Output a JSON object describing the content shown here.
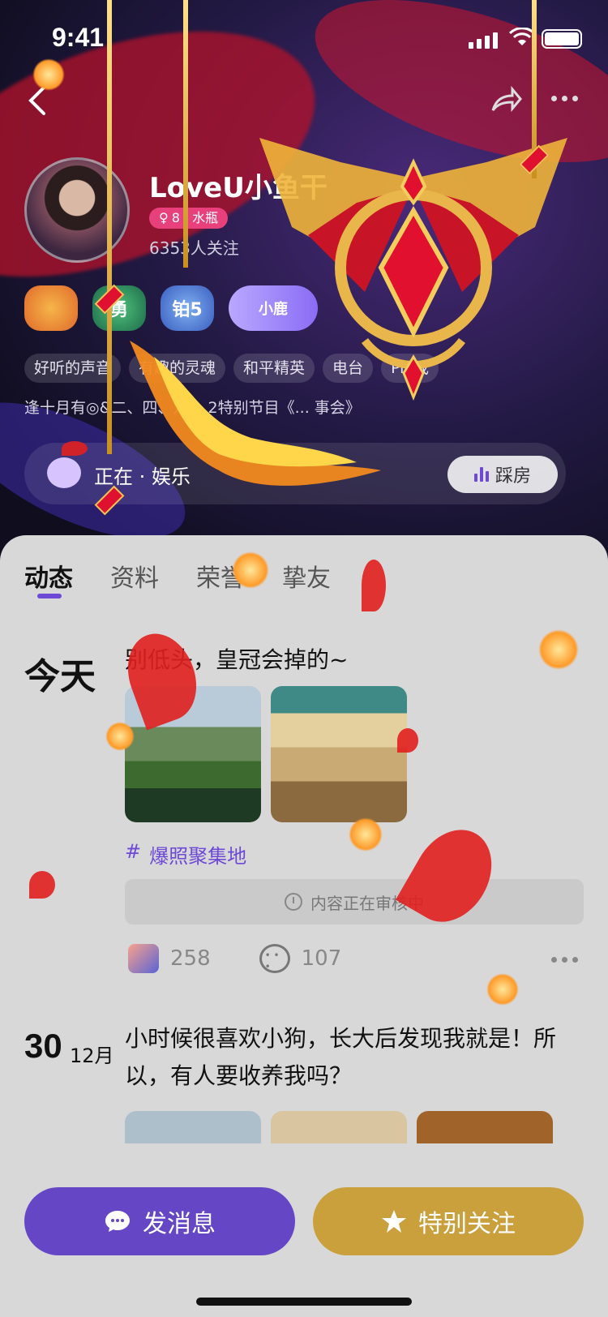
{
  "status_bar": {
    "time": "9:41"
  },
  "profile": {
    "name": "LoveU小鱼干",
    "tag": "8 · 水瓶",
    "followers": "6353人关注",
    "badges": [
      "",
      "勇",
      "铂5",
      "小鹿"
    ],
    "chips": [
      "好听的声音",
      "有趣的灵魂",
      "和平精英",
      "电台",
      "Pia戏"
    ],
    "bio": "逢十月有◎&二、四、六... 2特别节目《... 事会》",
    "room_text": "正在 · 娱乐",
    "room_button": "踩房"
  },
  "tabs": [
    "动态",
    "资料",
    "荣誉",
    "挚友"
  ],
  "posts": [
    {
      "date": "今天",
      "text": "别低头，皇冠会掉的~",
      "topic": "爆照聚集地",
      "review": "内容正在审核中",
      "likes": "258",
      "comments": "107"
    },
    {
      "day": "30",
      "month": "12月",
      "text": "小时候很喜欢小狗，长大后发现我就是！所以，有人要收养我吗？"
    }
  ],
  "bottom": {
    "message": "发消息",
    "follow": "特别关注"
  },
  "colors": {
    "accent": "#6d49d6",
    "follow_btn": "#c9a03b",
    "message_btn": "#6547c6"
  },
  "icons": [
    "back-icon",
    "share-icon",
    "more-icon",
    "clock-icon",
    "like-icon",
    "comment-icon",
    "chat-icon",
    "star-icon",
    "hash-icon"
  ]
}
